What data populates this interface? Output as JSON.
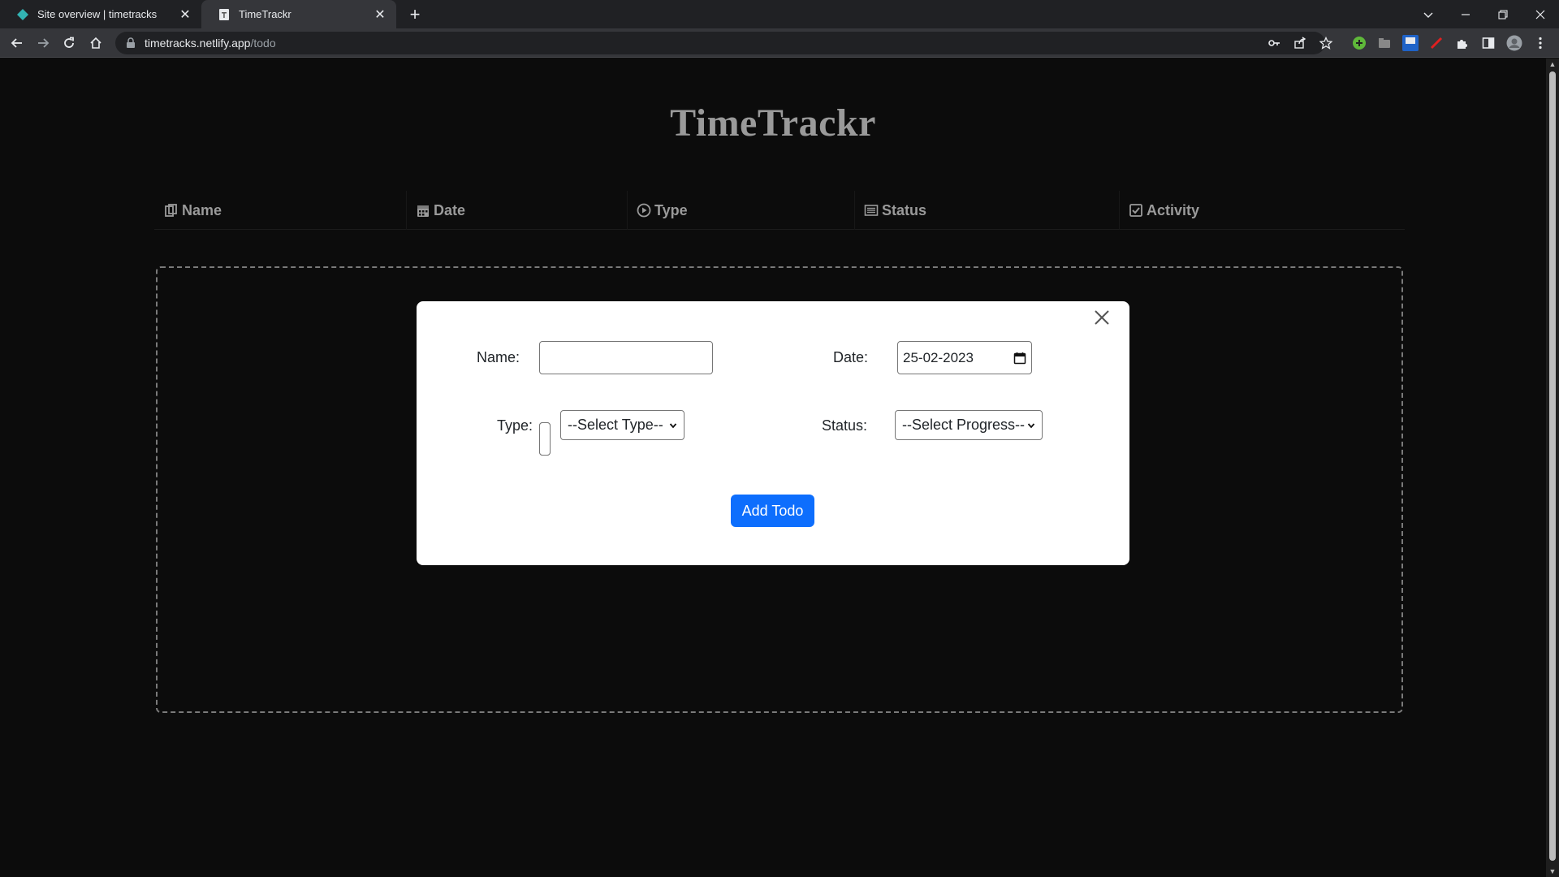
{
  "browser": {
    "tabs": [
      {
        "title": "Site overview | timetracks",
        "active": false,
        "favicon": "netlify-diamond-icon"
      },
      {
        "title": "TimeTrackr",
        "active": true,
        "favicon": "generic-page-icon"
      }
    ],
    "address": {
      "host": "timetracks.netlify.app",
      "path": "/todo"
    }
  },
  "app": {
    "title": "TimeTrackr",
    "columns": [
      {
        "label": "Name",
        "icon": "clipboard-icon"
      },
      {
        "label": "Date",
        "icon": "calendar-icon"
      },
      {
        "label": "Type",
        "icon": "play-circle-icon"
      },
      {
        "label": "Status",
        "icon": "list-icon"
      },
      {
        "label": "Activity",
        "icon": "check-square-icon"
      }
    ]
  },
  "modal": {
    "name_label": "Name:",
    "name_value": "",
    "date_label": "Date:",
    "date_value": "25-02-2023",
    "type_label": "Type:",
    "type_selected": "--Select Type--",
    "status_label": "Status:",
    "status_selected": "--Select Progress--",
    "submit_label": "Add Todo"
  },
  "colors": {
    "page_background": "#0c0c0c",
    "title_gray": "#9a9a9a",
    "accent_blue": "#0d6efd"
  }
}
